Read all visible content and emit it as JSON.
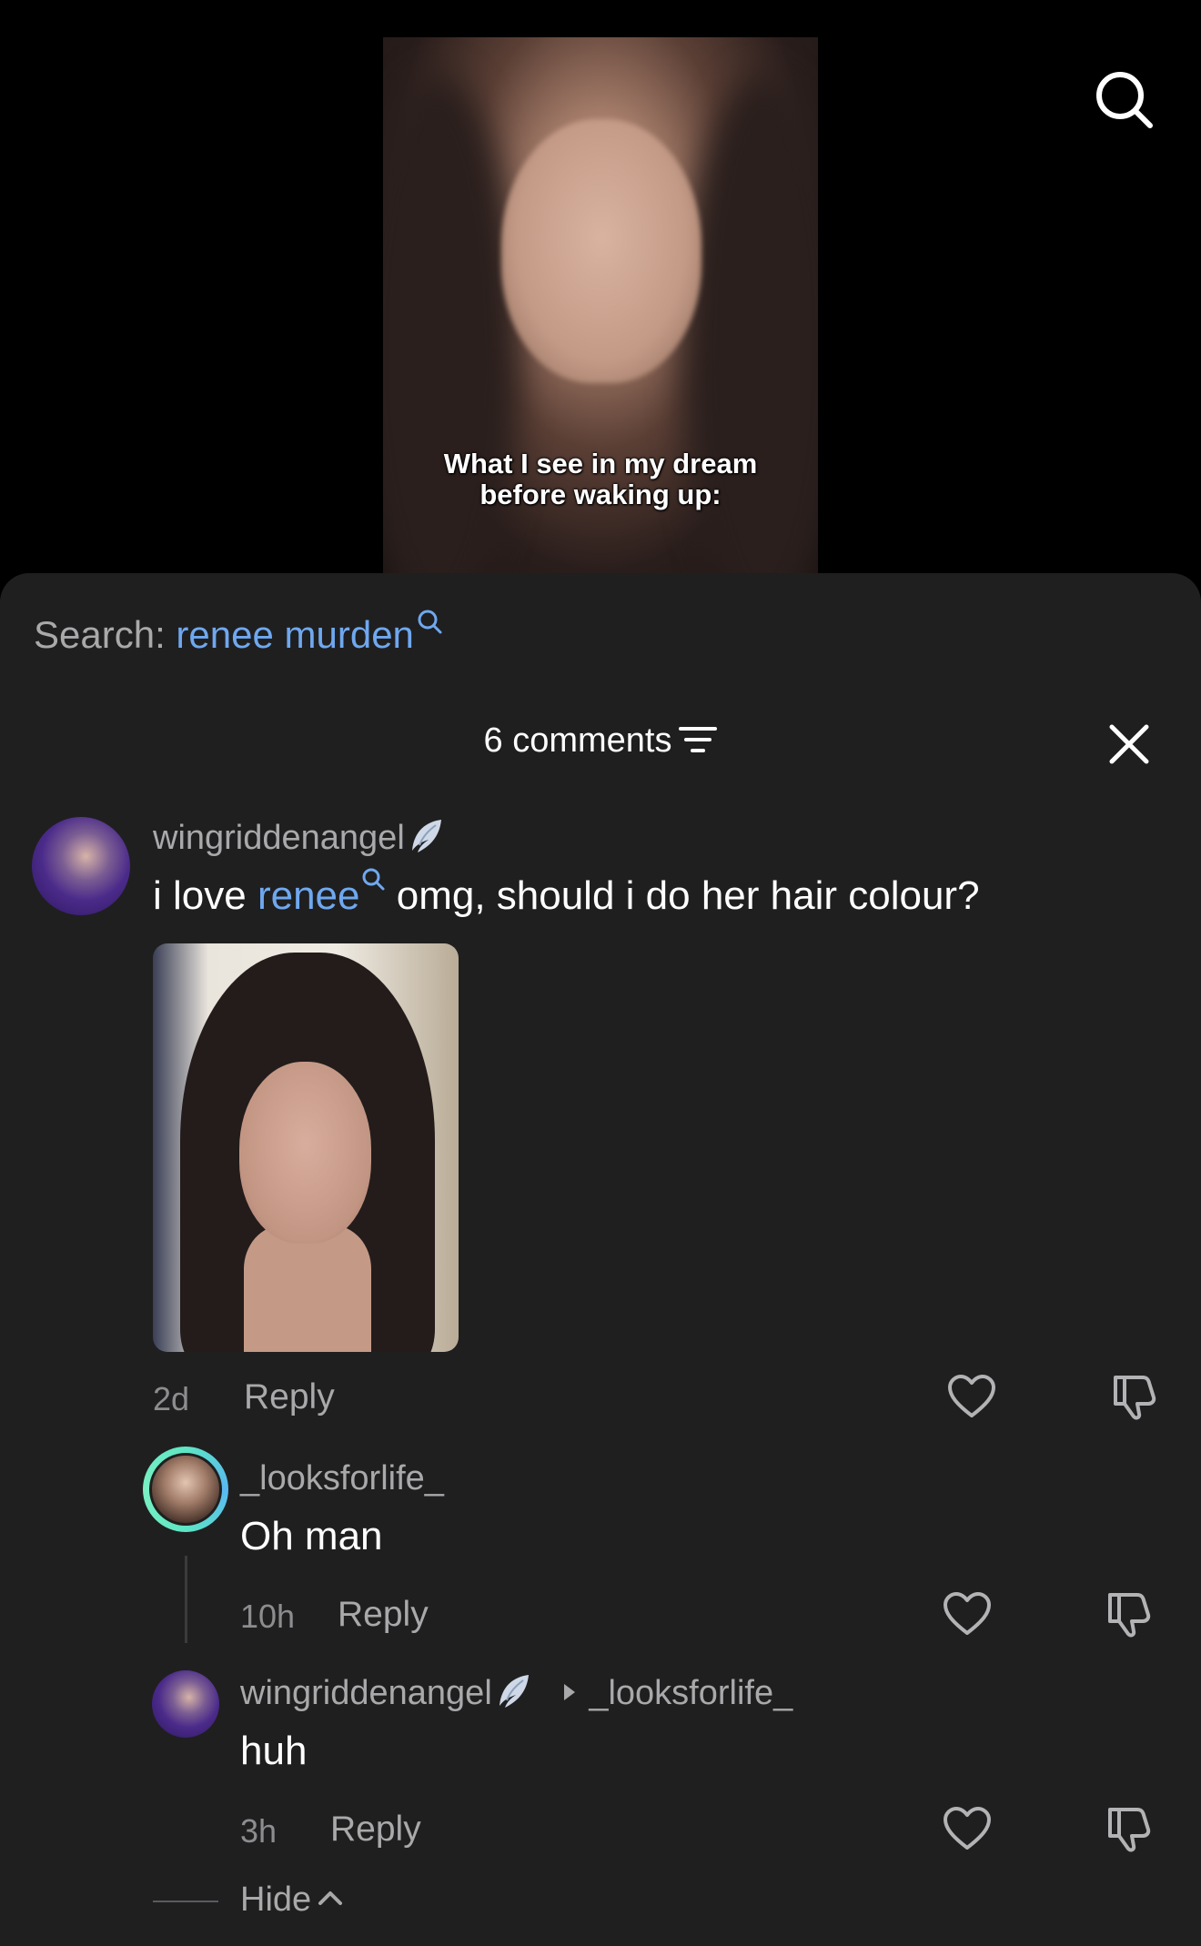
{
  "video": {
    "caption_line1": "What I see in my dream",
    "caption_line2": "before waking up:"
  },
  "search": {
    "label": "Search: ",
    "query": "renee murden"
  },
  "comments": {
    "count_label": "6 comments"
  },
  "thread": {
    "main": {
      "username": "wingriddenangel",
      "text_before": "i love ",
      "mention": "renee",
      "text_after": " omg, should i do her hair colour?",
      "time": "2d",
      "reply_label": "Reply"
    },
    "reply1": {
      "username": "_looksforlife_",
      "text": "Oh man",
      "time": "10h",
      "reply_label": "Reply"
    },
    "reply2": {
      "username": "wingriddenangel",
      "reply_to": "_looksforlife_",
      "text": "huh",
      "time": "3h",
      "reply_label": "Reply"
    },
    "hide_label": "Hide"
  },
  "icons": {
    "top_search": "search-icon",
    "filter": "filter-icon",
    "close": "close-icon",
    "like": "heart-icon",
    "dislike": "thumbs-down-icon",
    "wing": "angel-wing-icon"
  },
  "colors": {
    "accent": "#6fa8ef",
    "sheet_bg": "#1f1f20",
    "muted_text": "#a9a9ab"
  }
}
